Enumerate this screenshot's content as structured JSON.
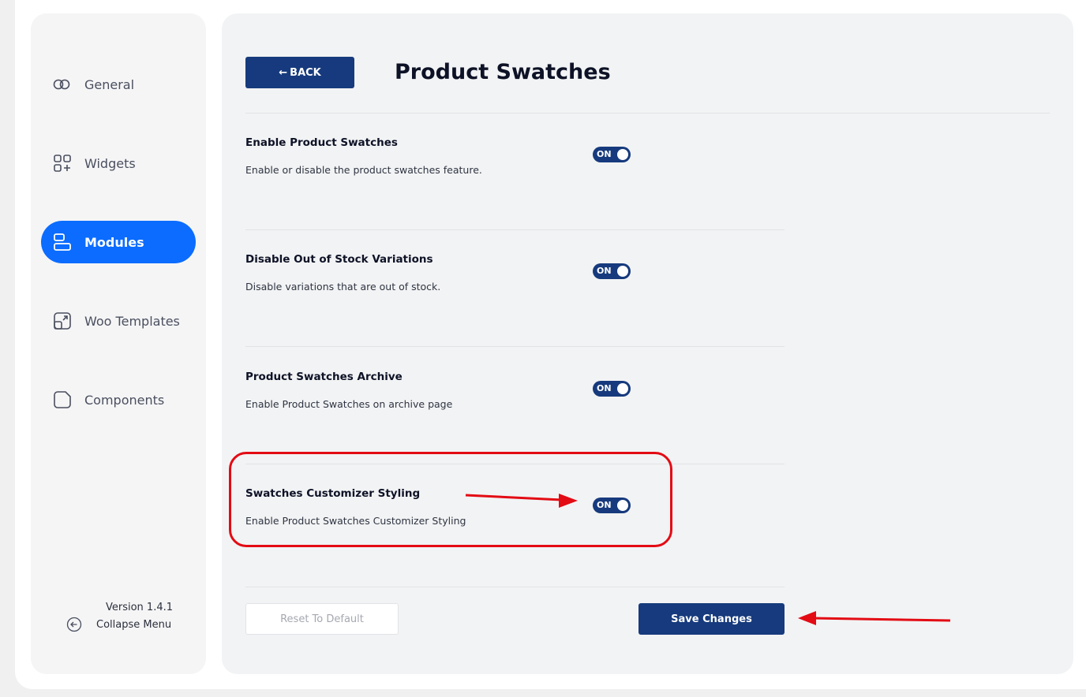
{
  "sidebar": {
    "items": [
      {
        "label": "General",
        "icon": "toggle-circles-icon",
        "active": false
      },
      {
        "label": "Widgets",
        "icon": "widgets-grid-icon",
        "active": false
      },
      {
        "label": "Modules",
        "icon": "modules-stack-icon",
        "active": true
      },
      {
        "label": "Woo Templates",
        "icon": "template-expand-icon",
        "active": false
      },
      {
        "label": "Components",
        "icon": "component-folder-icon",
        "active": false
      }
    ],
    "version": "Version 1.4.1",
    "collapse_label": "Collapse Menu"
  },
  "header": {
    "back_label": "BACK",
    "title": "Product Swatches"
  },
  "settings": [
    {
      "title": "Enable Product Swatches",
      "description": "Enable or disable the product swatches feature.",
      "toggle": "ON"
    },
    {
      "title": "Disable Out of Stock Variations",
      "description": "Disable variations that are out of stock.",
      "toggle": "ON"
    },
    {
      "title": "Product Swatches Archive",
      "description": "Enable Product Swatches on archive page",
      "toggle": "ON"
    },
    {
      "title": "Swatches Customizer Styling",
      "description": "Enable Product Swatches Customizer Styling",
      "toggle": "ON"
    }
  ],
  "footer": {
    "reset_label": "Reset To Default",
    "save_label": "Save Changes"
  },
  "colors": {
    "primary": "#163a7d",
    "active_nav": "#0b6cff",
    "annotation": "#e30b14"
  }
}
